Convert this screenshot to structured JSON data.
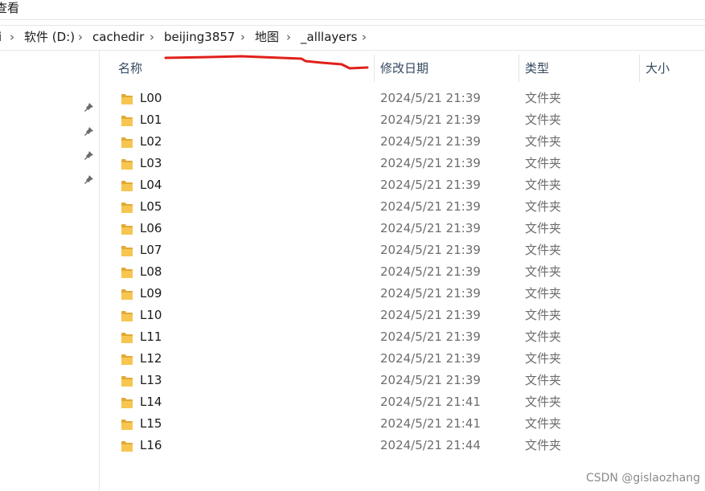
{
  "menubar": {
    "view_label": "查看"
  },
  "breadcrumb": [
    {
      "label": "i"
    },
    {
      "label": "软件 (D:)"
    },
    {
      "label": "cachedir"
    },
    {
      "label": "beijing3857"
    },
    {
      "label": "地图"
    },
    {
      "label": "_alllayers"
    }
  ],
  "columns": {
    "name": "名称",
    "modified": "修改日期",
    "type": "类型",
    "size": "大小"
  },
  "files": [
    {
      "name": "L00",
      "modified": "2024/5/21 21:39",
      "type": "文件夹"
    },
    {
      "name": "L01",
      "modified": "2024/5/21 21:39",
      "type": "文件夹"
    },
    {
      "name": "L02",
      "modified": "2024/5/21 21:39",
      "type": "文件夹"
    },
    {
      "name": "L03",
      "modified": "2024/5/21 21:39",
      "type": "文件夹"
    },
    {
      "name": "L04",
      "modified": "2024/5/21 21:39",
      "type": "文件夹"
    },
    {
      "name": "L05",
      "modified": "2024/5/21 21:39",
      "type": "文件夹"
    },
    {
      "name": "L06",
      "modified": "2024/5/21 21:39",
      "type": "文件夹"
    },
    {
      "name": "L07",
      "modified": "2024/5/21 21:39",
      "type": "文件夹"
    },
    {
      "name": "L08",
      "modified": "2024/5/21 21:39",
      "type": "文件夹"
    },
    {
      "name": "L09",
      "modified": "2024/5/21 21:39",
      "type": "文件夹"
    },
    {
      "name": "L10",
      "modified": "2024/5/21 21:39",
      "type": "文件夹"
    },
    {
      "name": "L11",
      "modified": "2024/5/21 21:39",
      "type": "文件夹"
    },
    {
      "name": "L12",
      "modified": "2024/5/21 21:39",
      "type": "文件夹"
    },
    {
      "name": "L13",
      "modified": "2024/5/21 21:39",
      "type": "文件夹"
    },
    {
      "name": "L14",
      "modified": "2024/5/21 21:41",
      "type": "文件夹"
    },
    {
      "name": "L15",
      "modified": "2024/5/21 21:41",
      "type": "文件夹"
    },
    {
      "name": "L16",
      "modified": "2024/5/21 21:44",
      "type": "文件夹"
    }
  ],
  "watermark": "CSDN @gislaozhang",
  "colors": {
    "folder": "#f6c650",
    "folder_dark": "#e2a935",
    "annotation": "#e0201b"
  },
  "icons": {
    "folder": "folder-icon",
    "pin": "pin-icon",
    "chevron": "chevron-right-icon"
  }
}
